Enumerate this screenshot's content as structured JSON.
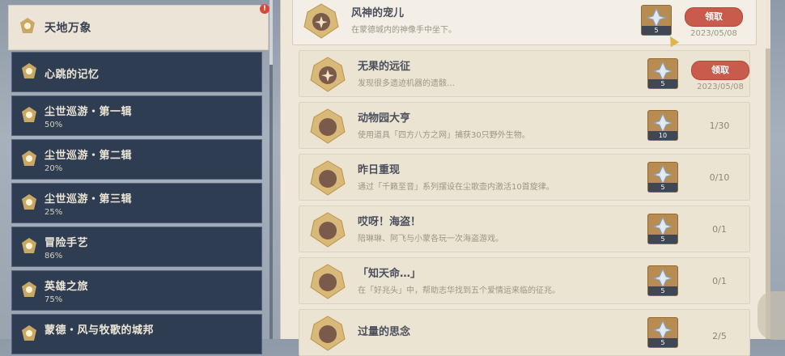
{
  "categories": [
    {
      "name": "天地万象",
      "percent": "",
      "selected": true,
      "alert": "!"
    },
    {
      "name": "心跳的记忆",
      "percent": ""
    },
    {
      "name": "尘世巡游・第一辑",
      "percent": "50%"
    },
    {
      "name": "尘世巡游・第二辑",
      "percent": "20%"
    },
    {
      "name": "尘世巡游・第三辑",
      "percent": "25%"
    },
    {
      "name": "冒险手艺",
      "percent": "86%"
    },
    {
      "name": "英雄之旅",
      "percent": "75%"
    },
    {
      "name": "蒙德・风与牧歌的城邦",
      "percent": ""
    }
  ],
  "achievements": [
    {
      "title": "风神的宠儿",
      "desc": "在蒙德城内的神像手中坐下。",
      "reward": "5",
      "action": "领取",
      "date": "2023/05/08"
    },
    {
      "title": "无果的远征",
      "desc": "发现很多遗迹机器的遗骸…",
      "reward": "5",
      "action": "领取",
      "date": "2023/05/08"
    },
    {
      "title": "动物园大亨",
      "desc": "使用道具「四方八方之网」捕获30只野外生物。",
      "reward": "10",
      "progress": "1/30"
    },
    {
      "title": "昨日重现",
      "desc": "通过「千籁至音」系列摆设在尘歌壶内激活10首旋律。",
      "reward": "5",
      "progress": "0/10"
    },
    {
      "title": "哎呀！海盗！",
      "desc": "陪琳琳、阿飞与小蒙各玩一次海盗游戏。",
      "reward": "5",
      "progress": "0/1"
    },
    {
      "title": "「知天命…」",
      "desc": "在「好兆头」中，帮助志华找到五个爱情运来临的征兆。",
      "reward": "5",
      "progress": "0/1"
    },
    {
      "title": "过量的思念",
      "desc": "",
      "reward": "5",
      "progress": "2/5"
    }
  ],
  "colors": {
    "claim": "#c85b4b",
    "panel": "#efe8da",
    "category_bg": "#2f3d52"
  }
}
